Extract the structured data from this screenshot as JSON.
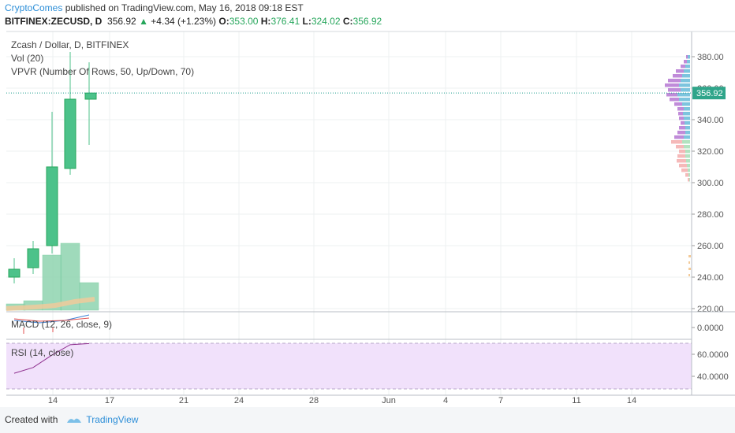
{
  "header": {
    "author": "CryptoComes",
    "published": "published on TradingView.com, May 16, 2018 09:18 EST",
    "symbol": "BITFINEX:ZECUSD, D",
    "last": "356.92",
    "change_arrow": "▲",
    "change": "+4.34 (+1.23%)",
    "o_label": "O:",
    "o_value": "353.00",
    "h_label": "H:",
    "h_value": "376.41",
    "l_label": "L:",
    "l_value": "324.02",
    "c_label": "C:",
    "c_value": "356.92"
  },
  "panes": {
    "main_title": "Zcash / Dollar, D, BITFINEX",
    "vol_label": "Vol (20)",
    "vpvr_label": "VPVR (Number Of Rows, 50, Up/Down, 70)",
    "macd_label": "MACD (12, 26, close, 9)",
    "rsi_label": "RSI (14, close)"
  },
  "footer": {
    "created_with": "Created with",
    "brand": "TradingView"
  },
  "colors": {
    "up": "#26a65b",
    "up_fill": "#4cc28a",
    "vol": "#8fd4b0",
    "vol_ma": "#f5c99a",
    "vpvr_up": "#5bb5d6",
    "vpvr_down": "#b06ed0",
    "rsi_line": "#8e2f8e",
    "rsi_bg": "#f1e1fb",
    "macd_line": "#3a7fd5",
    "signal_line": "#e05050",
    "price_line": "#1e9e8e"
  },
  "chart_data": {
    "type": "candlestick",
    "price_axis": {
      "ticks": [
        380,
        360,
        340,
        320,
        300,
        280,
        260,
        240,
        220
      ],
      "labels": [
        "380.00",
        "360.00",
        "340.00",
        "320.00",
        "300.00",
        "280.00",
        "260.00",
        "240.00",
        "220.00"
      ],
      "ylim": [
        216,
        389
      ]
    },
    "current_price": "356.92",
    "x_ticks": [
      "14",
      "17",
      "21",
      "24",
      "28",
      "Jun",
      "4",
      "7",
      "11",
      "14"
    ],
    "candles": [
      {
        "open": 240,
        "close": 245,
        "high": 252,
        "low": 236
      },
      {
        "open": 246,
        "close": 258,
        "high": 263,
        "low": 242
      },
      {
        "open": 260,
        "close": 310,
        "high": 345,
        "low": 255
      },
      {
        "open": 309,
        "close": 353,
        "high": 383,
        "low": 305
      },
      {
        "open": 353.0,
        "close": 356.92,
        "high": 376.41,
        "low": 324.02
      }
    ],
    "volume": [
      8,
      12,
      70,
      85,
      35
    ],
    "macd_axis": {
      "ticks": [
        "0.0000"
      ]
    },
    "rsi_axis": {
      "ticks": [
        "60.0000",
        "40.0000"
      ]
    },
    "rsi": [
      42,
      47,
      58,
      67,
      68
    ]
  }
}
